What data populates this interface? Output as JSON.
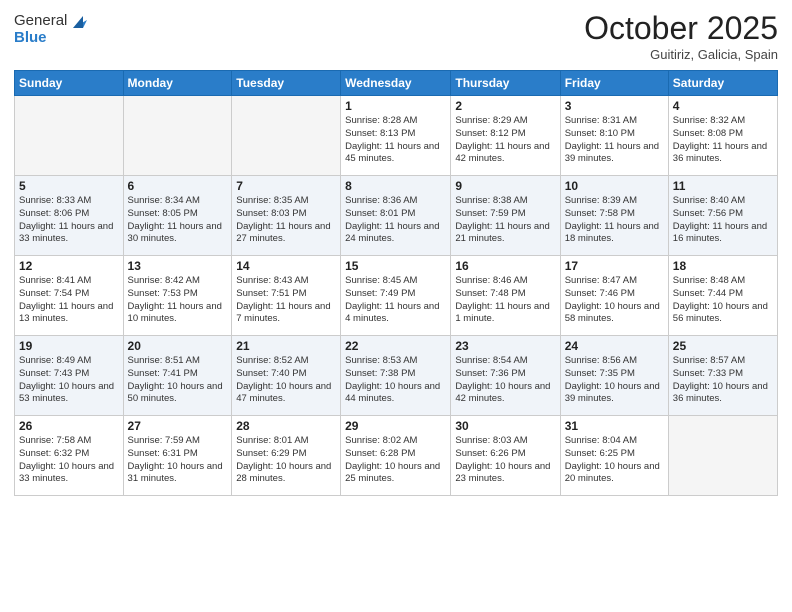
{
  "header": {
    "logo_line1": "General",
    "logo_line2": "Blue",
    "month": "October 2025",
    "location": "Guitiriz, Galicia, Spain"
  },
  "days_of_week": [
    "Sunday",
    "Monday",
    "Tuesday",
    "Wednesday",
    "Thursday",
    "Friday",
    "Saturday"
  ],
  "weeks": [
    [
      {
        "day": "",
        "sunrise": "",
        "sunset": "",
        "daylight": ""
      },
      {
        "day": "",
        "sunrise": "",
        "sunset": "",
        "daylight": ""
      },
      {
        "day": "",
        "sunrise": "",
        "sunset": "",
        "daylight": ""
      },
      {
        "day": "1",
        "sunrise": "Sunrise: 8:28 AM",
        "sunset": "Sunset: 8:13 PM",
        "daylight": "Daylight: 11 hours and 45 minutes."
      },
      {
        "day": "2",
        "sunrise": "Sunrise: 8:29 AM",
        "sunset": "Sunset: 8:12 PM",
        "daylight": "Daylight: 11 hours and 42 minutes."
      },
      {
        "day": "3",
        "sunrise": "Sunrise: 8:31 AM",
        "sunset": "Sunset: 8:10 PM",
        "daylight": "Daylight: 11 hours and 39 minutes."
      },
      {
        "day": "4",
        "sunrise": "Sunrise: 8:32 AM",
        "sunset": "Sunset: 8:08 PM",
        "daylight": "Daylight: 11 hours and 36 minutes."
      }
    ],
    [
      {
        "day": "5",
        "sunrise": "Sunrise: 8:33 AM",
        "sunset": "Sunset: 8:06 PM",
        "daylight": "Daylight: 11 hours and 33 minutes."
      },
      {
        "day": "6",
        "sunrise": "Sunrise: 8:34 AM",
        "sunset": "Sunset: 8:05 PM",
        "daylight": "Daylight: 11 hours and 30 minutes."
      },
      {
        "day": "7",
        "sunrise": "Sunrise: 8:35 AM",
        "sunset": "Sunset: 8:03 PM",
        "daylight": "Daylight: 11 hours and 27 minutes."
      },
      {
        "day": "8",
        "sunrise": "Sunrise: 8:36 AM",
        "sunset": "Sunset: 8:01 PM",
        "daylight": "Daylight: 11 hours and 24 minutes."
      },
      {
        "day": "9",
        "sunrise": "Sunrise: 8:38 AM",
        "sunset": "Sunset: 7:59 PM",
        "daylight": "Daylight: 11 hours and 21 minutes."
      },
      {
        "day": "10",
        "sunrise": "Sunrise: 8:39 AM",
        "sunset": "Sunset: 7:58 PM",
        "daylight": "Daylight: 11 hours and 18 minutes."
      },
      {
        "day": "11",
        "sunrise": "Sunrise: 8:40 AM",
        "sunset": "Sunset: 7:56 PM",
        "daylight": "Daylight: 11 hours and 16 minutes."
      }
    ],
    [
      {
        "day": "12",
        "sunrise": "Sunrise: 8:41 AM",
        "sunset": "Sunset: 7:54 PM",
        "daylight": "Daylight: 11 hours and 13 minutes."
      },
      {
        "day": "13",
        "sunrise": "Sunrise: 8:42 AM",
        "sunset": "Sunset: 7:53 PM",
        "daylight": "Daylight: 11 hours and 10 minutes."
      },
      {
        "day": "14",
        "sunrise": "Sunrise: 8:43 AM",
        "sunset": "Sunset: 7:51 PM",
        "daylight": "Daylight: 11 hours and 7 minutes."
      },
      {
        "day": "15",
        "sunrise": "Sunrise: 8:45 AM",
        "sunset": "Sunset: 7:49 PM",
        "daylight": "Daylight: 11 hours and 4 minutes."
      },
      {
        "day": "16",
        "sunrise": "Sunrise: 8:46 AM",
        "sunset": "Sunset: 7:48 PM",
        "daylight": "Daylight: 11 hours and 1 minute."
      },
      {
        "day": "17",
        "sunrise": "Sunrise: 8:47 AM",
        "sunset": "Sunset: 7:46 PM",
        "daylight": "Daylight: 10 hours and 58 minutes."
      },
      {
        "day": "18",
        "sunrise": "Sunrise: 8:48 AM",
        "sunset": "Sunset: 7:44 PM",
        "daylight": "Daylight: 10 hours and 56 minutes."
      }
    ],
    [
      {
        "day": "19",
        "sunrise": "Sunrise: 8:49 AM",
        "sunset": "Sunset: 7:43 PM",
        "daylight": "Daylight: 10 hours and 53 minutes."
      },
      {
        "day": "20",
        "sunrise": "Sunrise: 8:51 AM",
        "sunset": "Sunset: 7:41 PM",
        "daylight": "Daylight: 10 hours and 50 minutes."
      },
      {
        "day": "21",
        "sunrise": "Sunrise: 8:52 AM",
        "sunset": "Sunset: 7:40 PM",
        "daylight": "Daylight: 10 hours and 47 minutes."
      },
      {
        "day": "22",
        "sunrise": "Sunrise: 8:53 AM",
        "sunset": "Sunset: 7:38 PM",
        "daylight": "Daylight: 10 hours and 44 minutes."
      },
      {
        "day": "23",
        "sunrise": "Sunrise: 8:54 AM",
        "sunset": "Sunset: 7:36 PM",
        "daylight": "Daylight: 10 hours and 42 minutes."
      },
      {
        "day": "24",
        "sunrise": "Sunrise: 8:56 AM",
        "sunset": "Sunset: 7:35 PM",
        "daylight": "Daylight: 10 hours and 39 minutes."
      },
      {
        "day": "25",
        "sunrise": "Sunrise: 8:57 AM",
        "sunset": "Sunset: 7:33 PM",
        "daylight": "Daylight: 10 hours and 36 minutes."
      }
    ],
    [
      {
        "day": "26",
        "sunrise": "Sunrise: 7:58 AM",
        "sunset": "Sunset: 6:32 PM",
        "daylight": "Daylight: 10 hours and 33 minutes."
      },
      {
        "day": "27",
        "sunrise": "Sunrise: 7:59 AM",
        "sunset": "Sunset: 6:31 PM",
        "daylight": "Daylight: 10 hours and 31 minutes."
      },
      {
        "day": "28",
        "sunrise": "Sunrise: 8:01 AM",
        "sunset": "Sunset: 6:29 PM",
        "daylight": "Daylight: 10 hours and 28 minutes."
      },
      {
        "day": "29",
        "sunrise": "Sunrise: 8:02 AM",
        "sunset": "Sunset: 6:28 PM",
        "daylight": "Daylight: 10 hours and 25 minutes."
      },
      {
        "day": "30",
        "sunrise": "Sunrise: 8:03 AM",
        "sunset": "Sunset: 6:26 PM",
        "daylight": "Daylight: 10 hours and 23 minutes."
      },
      {
        "day": "31",
        "sunrise": "Sunrise: 8:04 AM",
        "sunset": "Sunset: 6:25 PM",
        "daylight": "Daylight: 10 hours and 20 minutes."
      },
      {
        "day": "",
        "sunrise": "",
        "sunset": "",
        "daylight": ""
      }
    ]
  ]
}
